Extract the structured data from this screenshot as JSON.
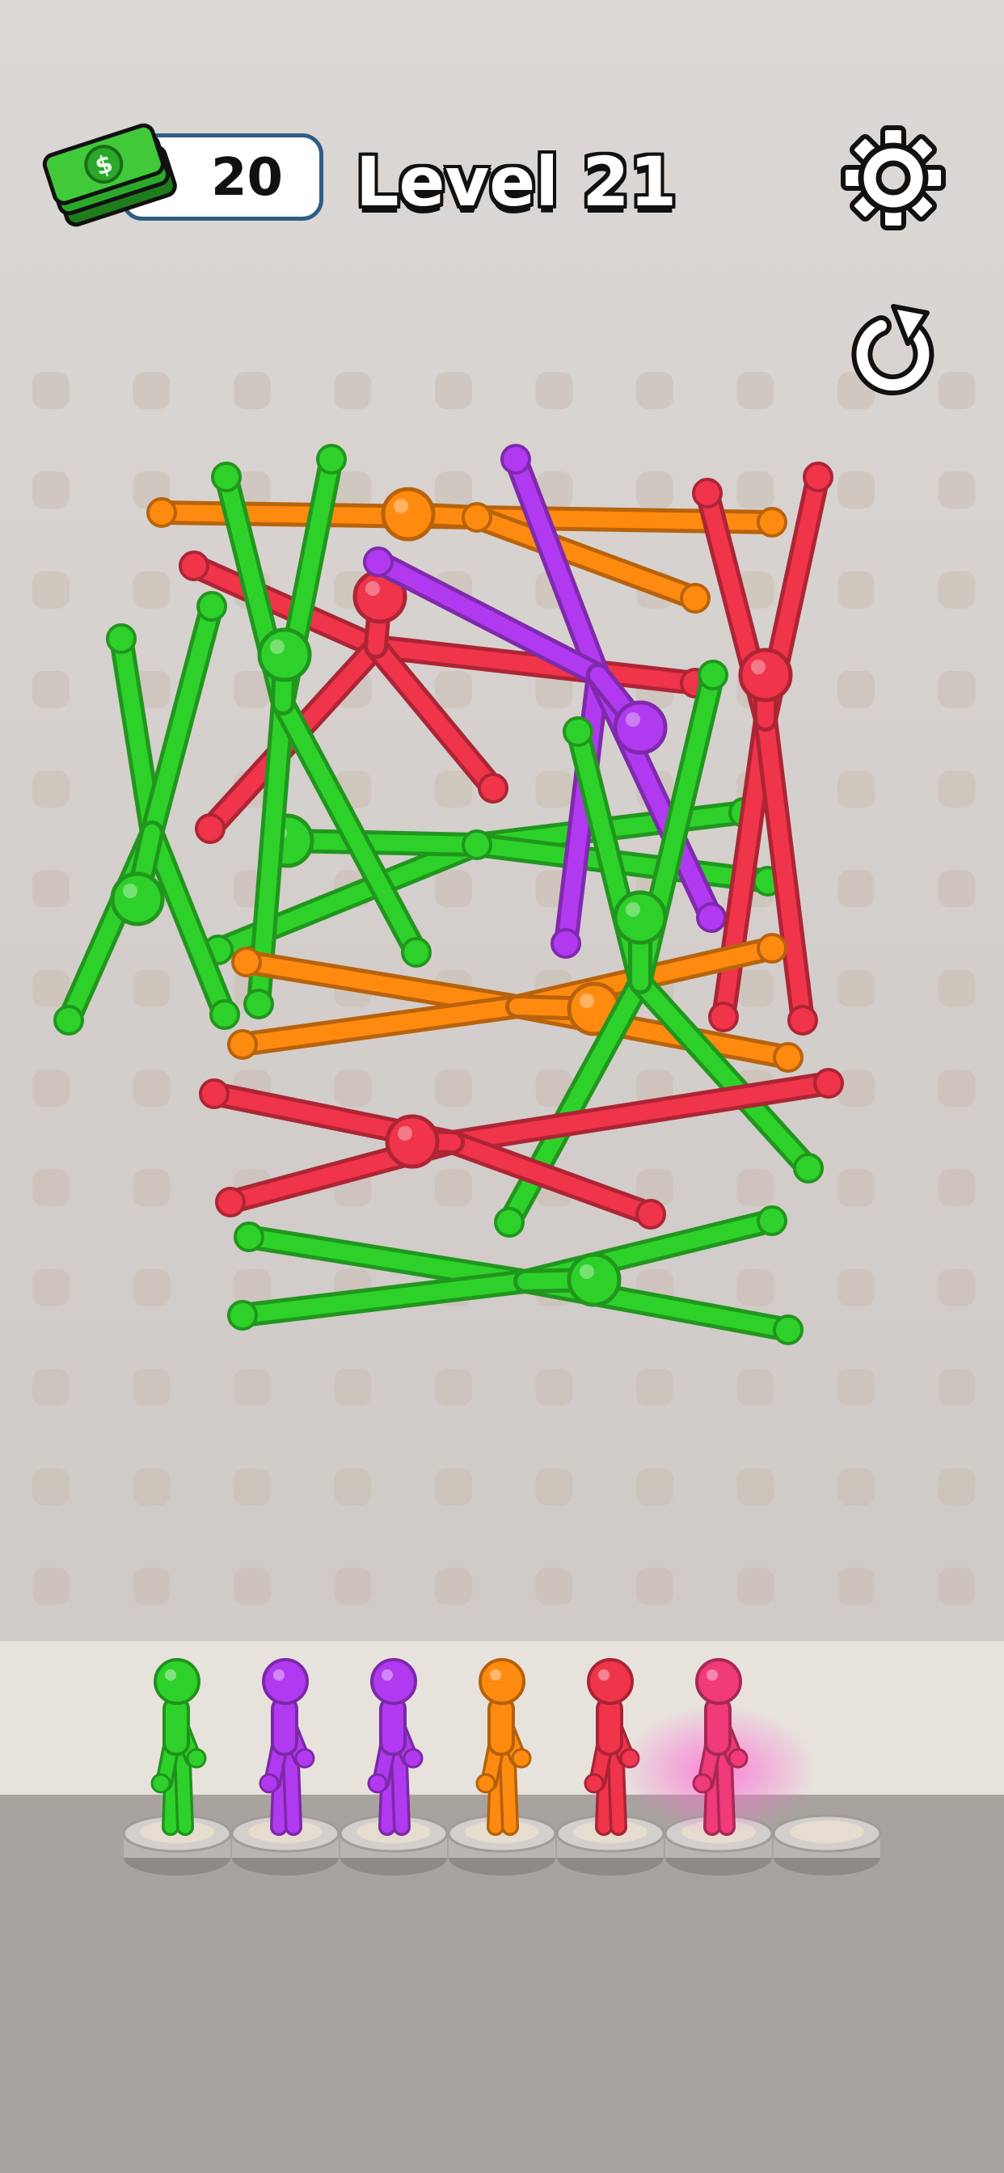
{
  "hud": {
    "coins": "20",
    "level_title": "Level 21",
    "money_icon": "cash-stack-icon",
    "settings_icon": "gear-icon",
    "restart_icon": "restart-icon"
  },
  "colors": {
    "green": "#2ed12a",
    "orange": "#ff8a10",
    "red": "#f0344a",
    "purple": "#b13af0",
    "pink": "#f03a7a",
    "peg": "#cbbeb2"
  },
  "board": {
    "peg_grid": {
      "columns": 10,
      "rows": 13
    },
    "stickmen_on_board": [
      {
        "color": "orange"
      },
      {
        "color": "green"
      },
      {
        "color": "red"
      },
      {
        "color": "purple"
      },
      {
        "color": "red"
      },
      {
        "color": "green"
      },
      {
        "color": "green"
      },
      {
        "color": "orange"
      },
      {
        "color": "green"
      },
      {
        "color": "red"
      },
      {
        "color": "green"
      }
    ]
  },
  "queue": {
    "slots": [
      {
        "color": "green",
        "occupied": true,
        "highlighted": false
      },
      {
        "color": "purple",
        "occupied": true,
        "highlighted": false
      },
      {
        "color": "purple",
        "occupied": true,
        "highlighted": false
      },
      {
        "color": "orange",
        "occupied": true,
        "highlighted": false
      },
      {
        "color": "red",
        "occupied": true,
        "highlighted": false
      },
      {
        "color": "pink",
        "occupied": true,
        "highlighted": true
      },
      {
        "color": "",
        "occupied": false,
        "highlighted": false
      }
    ]
  }
}
